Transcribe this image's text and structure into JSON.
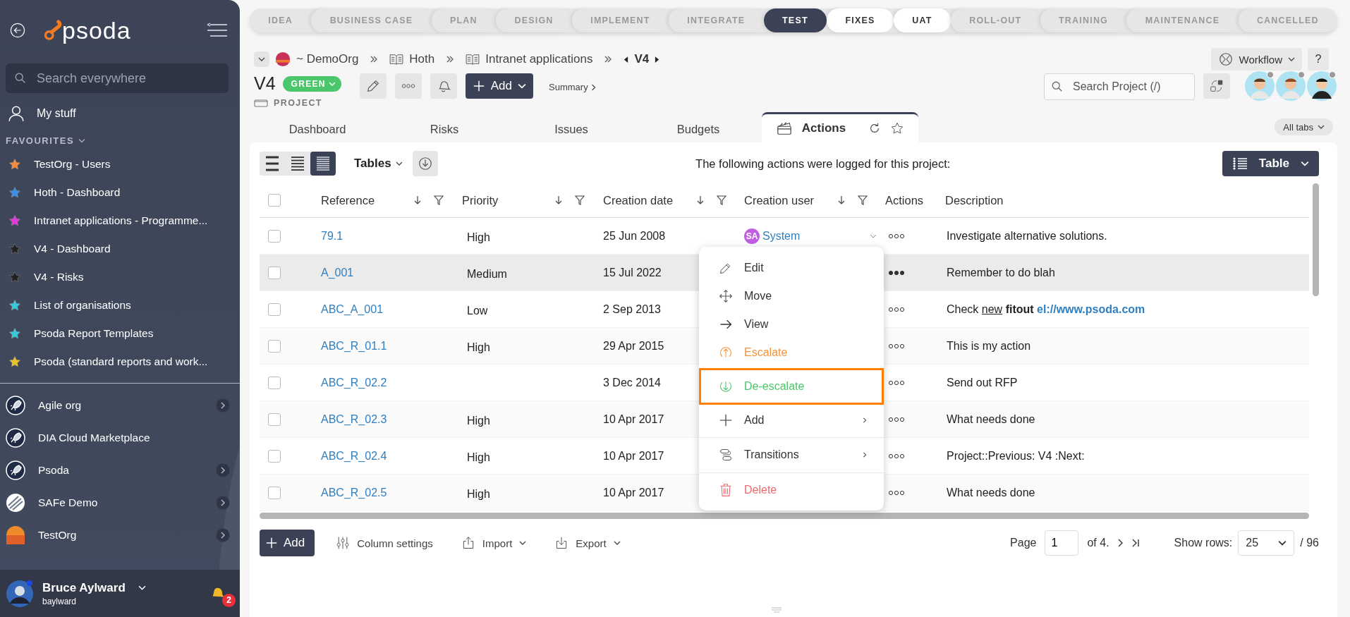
{
  "sidebar": {
    "logo": "psoda",
    "search": {
      "placeholder": "Search everywhere"
    },
    "my_stuff": "My stuff",
    "favourites_heading": "FAVOURITES",
    "favourites": [
      {
        "label": "TestOrg - Users",
        "color": "#f58b3c"
      },
      {
        "label": "Hoth - Dashboard",
        "color": "#3d8fe8"
      },
      {
        "label": "Intranet applications - Programme...",
        "color": "#e03ad9"
      },
      {
        "label": "V4 - Dashboard",
        "color": "#222222"
      },
      {
        "label": "V4 - Risks",
        "color": "#222222"
      },
      {
        "label": "List of organisations",
        "color": "#35c9dc"
      },
      {
        "label": "Psoda Report Templates",
        "color": "#35c9dc"
      },
      {
        "label": "Psoda (standard reports and work...",
        "color": "#e8c02c"
      }
    ],
    "organisations": [
      {
        "label": "Agile org",
        "kind": "rocket",
        "expandable": true
      },
      {
        "label": "DIA Cloud Marketplace",
        "kind": "rocket",
        "expandable": false
      },
      {
        "label": "Psoda",
        "kind": "rocket",
        "expandable": true
      },
      {
        "label": "SAFe Demo",
        "kind": "stripes",
        "expandable": true
      },
      {
        "label": "TestOrg",
        "kind": "sunset",
        "expandable": true
      }
    ],
    "user": {
      "name": "Bruce Aylward",
      "login": "baylward",
      "notifications": "2"
    }
  },
  "stages": [
    {
      "label": "IDEA",
      "selected": false,
      "highlighted": false
    },
    {
      "label": "BUSINESS CASE",
      "selected": false,
      "highlighted": false
    },
    {
      "label": "PLAN",
      "selected": false,
      "highlighted": false
    },
    {
      "label": "DESIGN",
      "selected": false,
      "highlighted": false
    },
    {
      "label": "IMPLEMENT",
      "selected": false,
      "highlighted": false
    },
    {
      "label": "INTEGRATE",
      "selected": false,
      "highlighted": false
    },
    {
      "label": "TEST",
      "selected": true,
      "highlighted": false
    },
    {
      "label": "FIXES",
      "selected": false,
      "highlighted": true
    },
    {
      "label": "UAT",
      "selected": false,
      "highlighted": true
    },
    {
      "label": "ROLL-OUT",
      "selected": false,
      "highlighted": false
    },
    {
      "label": "TRAINING",
      "selected": false,
      "highlighted": false
    },
    {
      "label": "MAINTENANCE",
      "selected": false,
      "highlighted": false
    },
    {
      "label": "CANCELLED",
      "selected": false,
      "highlighted": false
    }
  ],
  "breadcrumb": [
    {
      "label": "~ DemoOrg",
      "kind": "org"
    },
    {
      "label": "Hoth",
      "kind": "book"
    },
    {
      "label": "Intranet applications",
      "kind": "book"
    },
    {
      "label": "V4",
      "kind": "current"
    }
  ],
  "project": {
    "title": "V4",
    "status": "GREEN",
    "type": "PROJECT",
    "add": "Add",
    "summary": "Summary",
    "workflow": "Workflow",
    "help": "?",
    "search": {
      "placeholder": "Search Project (/)"
    }
  },
  "tabs": [
    {
      "label": "Dashboard",
      "selected": false
    },
    {
      "label": "Risks",
      "selected": false
    },
    {
      "label": "Issues",
      "selected": false
    },
    {
      "label": "Budgets",
      "selected": false
    },
    {
      "label": "Actions",
      "selected": true
    }
  ],
  "all_tabs": "All tabs",
  "toolbar": {
    "view_modes": [
      {
        "selected": false
      },
      {
        "selected": false
      },
      {
        "selected": true
      }
    ],
    "tables": "Tables",
    "caption": "The following actions were logged for this project:",
    "table_button": "Table"
  },
  "table": {
    "all_checked": false,
    "columns": [
      {
        "label": "Reference",
        "sortable": true
      },
      {
        "label": "Priority",
        "sortable": true
      },
      {
        "label": "Creation date",
        "sortable": true
      },
      {
        "label": "Creation user",
        "sortable": true
      },
      {
        "label": "Actions"
      },
      {
        "label": "Description"
      }
    ],
    "rows": [
      {
        "checked": false,
        "hovered": false,
        "reference": "79.1",
        "priority": "High",
        "date": "25 Jun 2008",
        "user": {
          "initials": "SA",
          "name": "System"
        },
        "description": [
          {
            "text": "Investigate alternative solutions.",
            "kind": "plain"
          }
        ]
      },
      {
        "checked": false,
        "hovered": true,
        "reference": "A_001",
        "priority": "Medium",
        "date": "15 Jul 2022",
        "description": [
          {
            "text": "Remember to do blah",
            "kind": "plain"
          }
        ]
      },
      {
        "checked": false,
        "hovered": false,
        "reference": "ABC_A_001",
        "priority": "Low",
        "date": "2 Sep 2013",
        "description": [
          {
            "text": "Check",
            "kind": "plain"
          },
          {
            "text": "new",
            "kind": "underline"
          },
          {
            "text": "fitout",
            "kind": "bold"
          },
          {
            "text": "el://www.psoda.com",
            "kind": "link"
          }
        ]
      },
      {
        "checked": false,
        "hovered": false,
        "reference": "ABC_R_01.1",
        "priority": "High",
        "date": "29 Apr 2015",
        "description": [
          {
            "text": "This is my action",
            "kind": "plain"
          }
        ]
      },
      {
        "checked": false,
        "hovered": false,
        "reference": "ABC_R_02.2",
        "date": "3 Dec 2014",
        "description": [
          {
            "text": "Send out RFP",
            "kind": "plain"
          }
        ]
      },
      {
        "checked": false,
        "hovered": false,
        "reference": "ABC_R_02.3",
        "priority": "High",
        "date": "10 Apr 2017",
        "description": [
          {
            "text": "What needs done",
            "kind": "plain"
          }
        ]
      },
      {
        "checked": false,
        "hovered": false,
        "reference": "ABC_R_02.4",
        "priority": "High",
        "date": "10 Apr 2017",
        "description": [
          {
            "text": "Project::Previous: V4 :Next:",
            "kind": "plain"
          }
        ]
      },
      {
        "checked": false,
        "hovered": false,
        "reference": "ABC_R_02.5",
        "priority": "High",
        "date": "10 Apr 2017",
        "description": [
          {
            "text": "What needs done",
            "kind": "plain"
          }
        ]
      }
    ]
  },
  "menu": [
    {
      "label": "Edit",
      "kind": "edit",
      "highlighted": false,
      "submenu": false
    },
    {
      "label": "Move",
      "kind": "move",
      "highlighted": false,
      "submenu": false
    },
    {
      "label": "View",
      "kind": "view",
      "highlighted": false,
      "submenu": false
    },
    {
      "label": "Escalate",
      "kind": "escalate",
      "highlighted": false,
      "submenu": false
    },
    {
      "label": "De-escalate",
      "kind": "deescalate",
      "highlighted": true,
      "submenu": false
    },
    {
      "label": "Add",
      "kind": "add",
      "highlighted": false,
      "submenu": true
    },
    {
      "label": "Transitions",
      "kind": "transitions",
      "highlighted": false,
      "submenu": true,
      "divider_before": true
    },
    {
      "label": "Delete",
      "kind": "delete",
      "highlighted": false,
      "submenu": false,
      "divider_before": true
    }
  ],
  "footer": {
    "add": "Add",
    "column_settings": "Column settings",
    "import": "Import",
    "export": "Export",
    "page_label": "Page",
    "page": "1",
    "page_count": "of 4.",
    "show_rows": "Show rows:",
    "rows": "25",
    "total": "/ 96"
  }
}
